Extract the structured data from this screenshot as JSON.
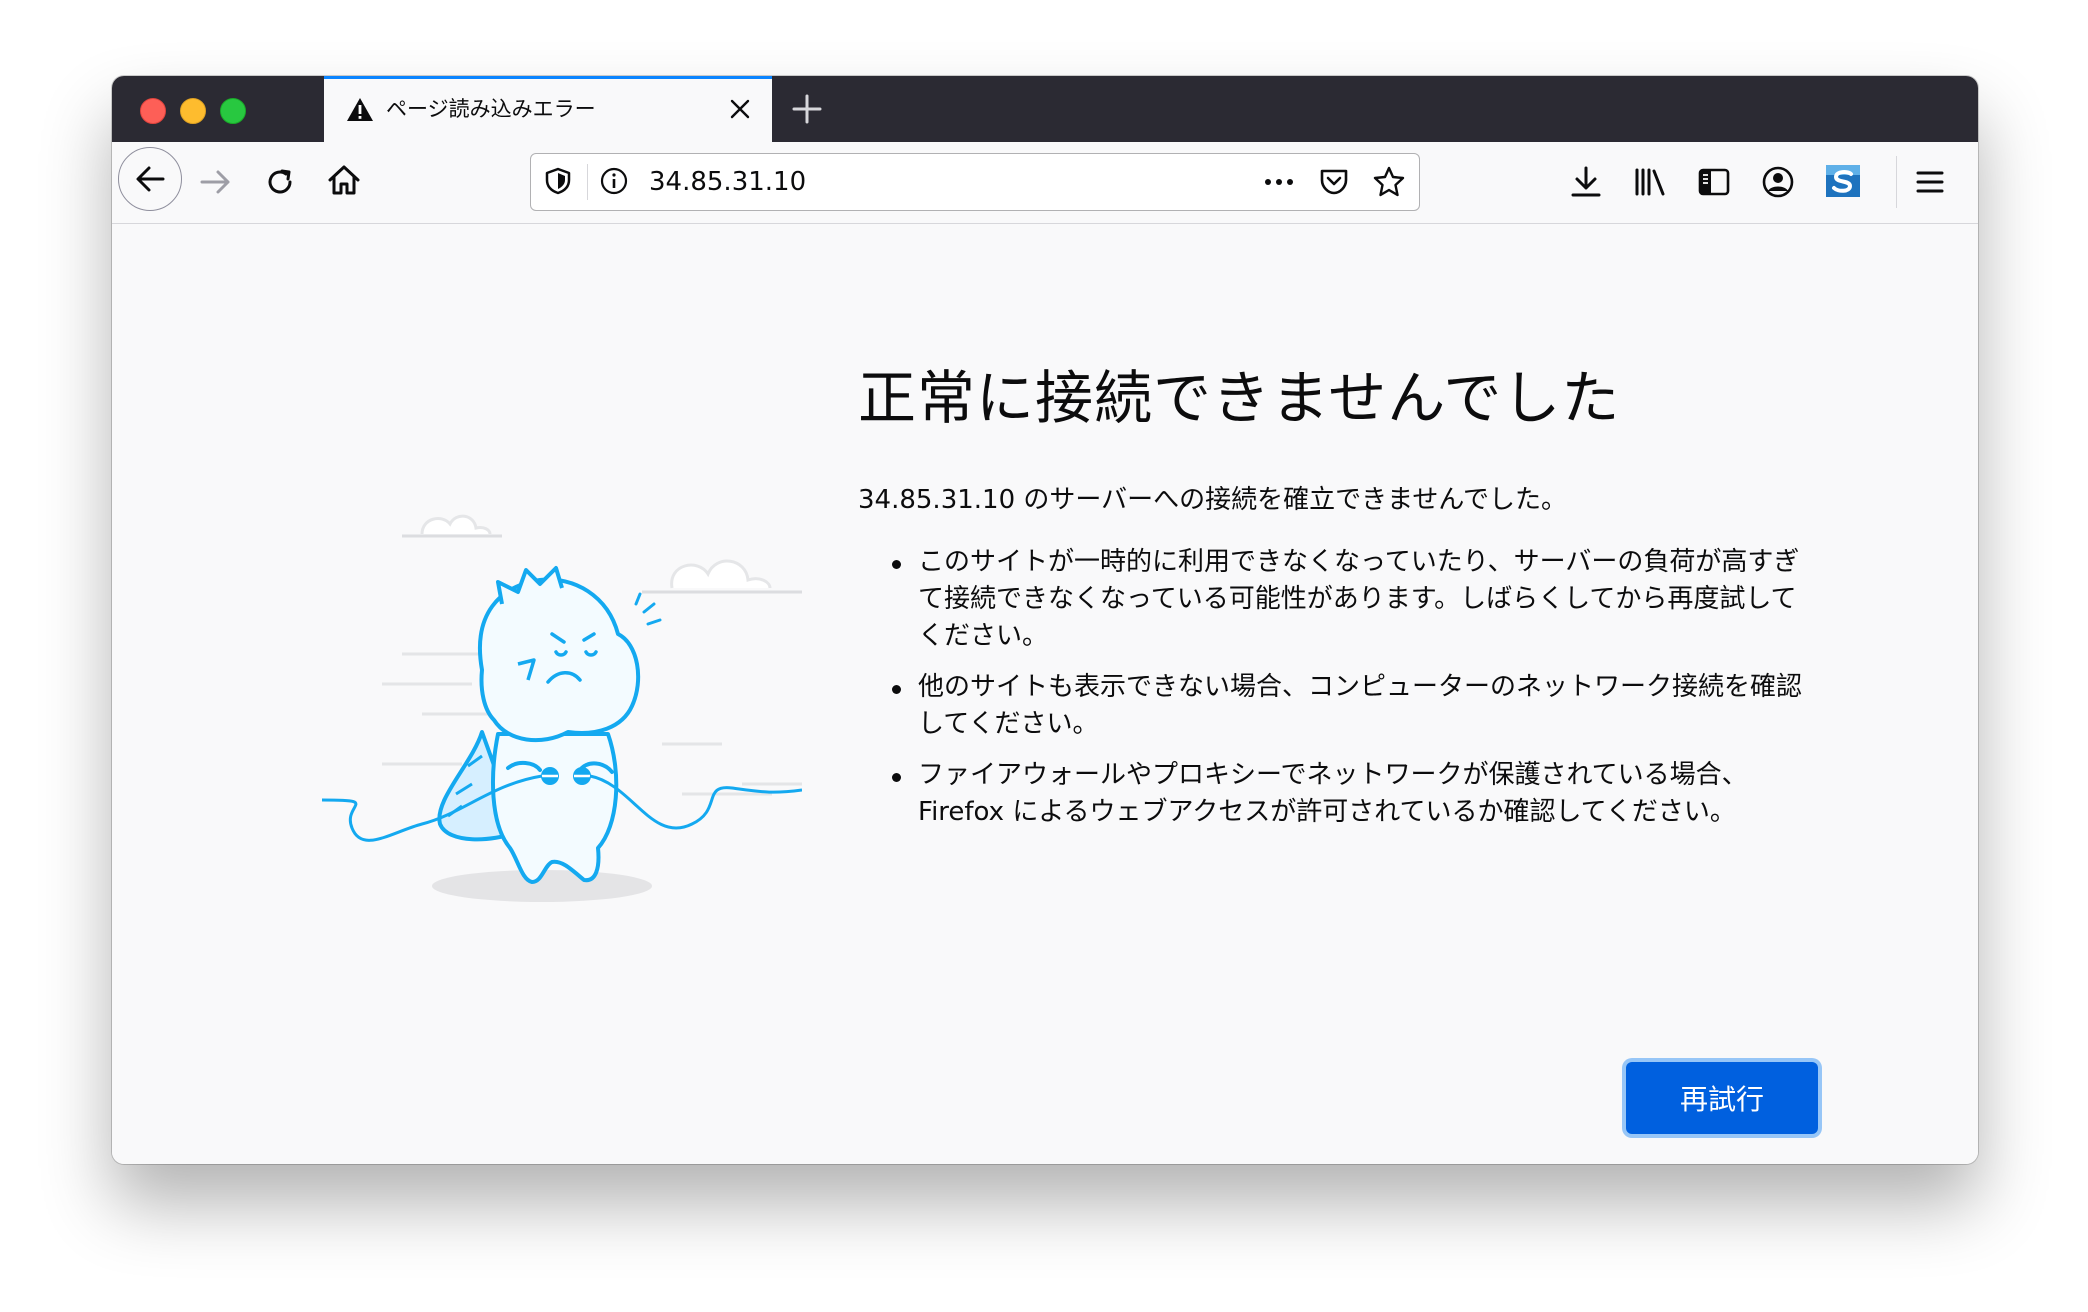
{
  "tab": {
    "title": "ページ読み込みエラー",
    "icon": "warning-icon"
  },
  "toolbar": {
    "url": "34.85.31.10",
    "icons": [
      "back-icon",
      "forward-icon",
      "reload-icon",
      "home-icon",
      "shield-icon",
      "info-icon",
      "more-icon",
      "pocket-icon",
      "bookmark-star-icon",
      "download-icon",
      "library-icon",
      "sidebar-icon",
      "account-icon",
      "extension-icon",
      "menu-icon"
    ]
  },
  "error": {
    "title": "正常に接続できませんでした",
    "description": "34.85.31.10 のサーバーへの接続を確立できませんでした。",
    "bullets": [
      "このサイトが一時的に利用できなくなっていたり、サーバーの負荷が高すぎて接続できなくなっている可能性があります。しばらくしてから再度試してください。",
      "他のサイトも表示できない場合、コンピューターのネットワーク接続を確認してください。",
      "ファイアウォールやプロキシーでネットワークが保護されている場合、Firefox によるウェブアクセスが許可されているか確認してください。"
    ],
    "retry_label": "再試行"
  },
  "colors": {
    "accent": "#0060df",
    "titlebar": "#2b2a33",
    "illustration": "#14a9f0"
  }
}
